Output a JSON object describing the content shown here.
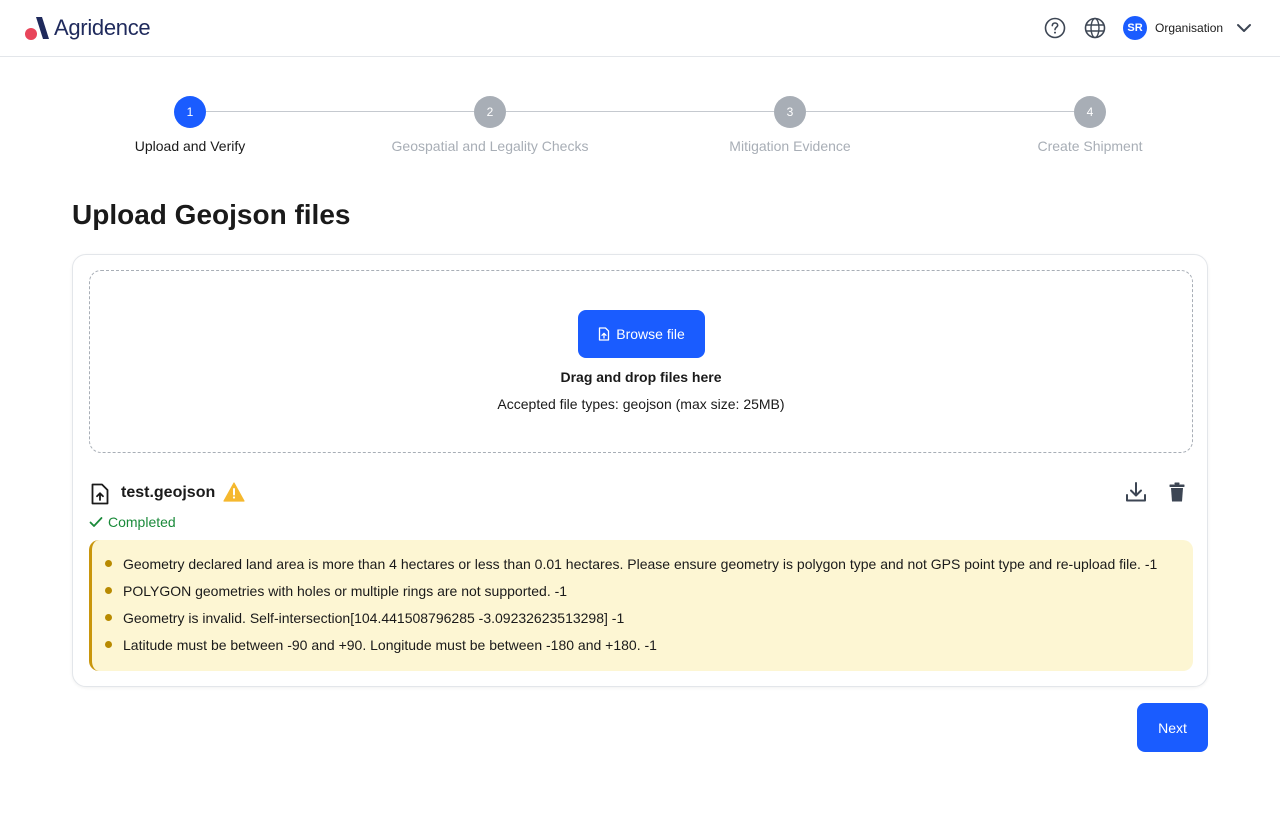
{
  "header": {
    "brand_name": "Agridence",
    "avatar_initials": "SR",
    "org_label": "Organisation",
    "colors": {
      "brand_dark": "#1f2a5c",
      "brand_accent": "#e8455a",
      "primary": "#1a5cff"
    }
  },
  "stepper": {
    "steps": [
      {
        "number": "1",
        "label": "Upload and Verify"
      },
      {
        "number": "2",
        "label": "Geospatial and Legality Checks"
      },
      {
        "number": "3",
        "label": "Mitigation Evidence"
      },
      {
        "number": "4",
        "label": "Create Shipment"
      }
    ],
    "active_step": 1
  },
  "page": {
    "title": "Upload Geojson files"
  },
  "dropzone": {
    "browse_label": "Browse file",
    "drop_text": "Drag and drop files here",
    "accepted_text": "Accepted file types: geojson (max size: 25MB)"
  },
  "file": {
    "name": "test.geojson",
    "status": "Completed",
    "warnings": [
      "Geometry declared land area is more than 4 hectares or less than 0.01 hectares. Please ensure geometry is polygon type and not GPS point type and re-upload file. -1",
      "POLYGON geometries with holes or multiple rings are not supported. -1",
      "Geometry is invalid. Self-intersection[104.441508796285 -3.09232623513298] -1",
      "Latitude must be between -90 and +90. Longitude must be between -180 and +180. -1"
    ]
  },
  "footer": {
    "next_label": "Next"
  }
}
